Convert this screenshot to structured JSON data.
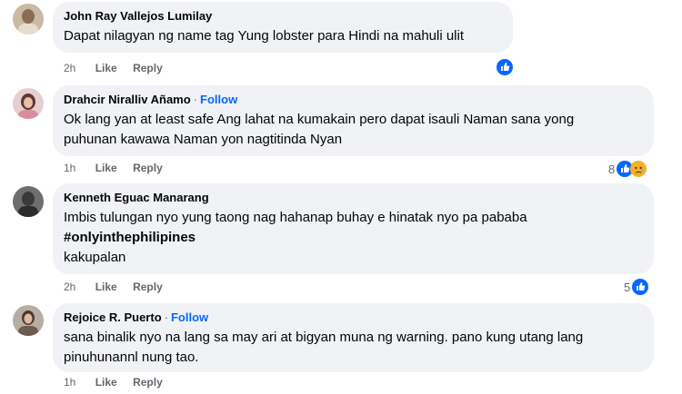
{
  "comments": [
    {
      "author": "John Ray Vallejos Lumilay",
      "follow": "",
      "lines": [
        "Dapat nilagyan ng name tag Yung lobster para Hindi na mahuli ulit"
      ],
      "hashtag": "",
      "time": "2h",
      "like": "Like",
      "reply": "Reply",
      "reaction_count": "",
      "reactions": [
        "like-icon"
      ]
    },
    {
      "author": "Drahcir Niralliv Añamo",
      "follow": "Follow",
      "lines": [
        "Ok lang yan at least safe Ang lahat na kumakain pero dapat isauli Naman sana yong",
        "puhunan kawawa Naman yon nagtitinda Nyan"
      ],
      "hashtag": "",
      "time": "1h",
      "like": "Like",
      "reply": "Reply",
      "reaction_count": "8",
      "reactions": [
        "like-icon",
        "sad-icon"
      ]
    },
    {
      "author": "Kenneth Eguac Manarang",
      "follow": "",
      "lines": [
        "Imbis tulungan nyo yung taong nag hahanap buhay e hinatak nyo pa pababa"
      ],
      "hashtag": "#onlyinthephilipines",
      "extra_line": "kakupalan",
      "time": "2h",
      "like": "Like",
      "reply": "Reply",
      "reaction_count": "5",
      "reactions": [
        "like-icon"
      ]
    },
    {
      "author": "Rejoice R. Puerto",
      "follow": "Follow",
      "lines": [
        "sana binalik nyo na lang sa may ari at bigyan muna ng warning. pano kung utang lang",
        "pinuhunannl nung tao."
      ],
      "hashtag": "",
      "time": "1h",
      "like": "Like",
      "reply": "Reply",
      "reaction_count": "",
      "reactions": []
    }
  ],
  "colors": {
    "bubble": "#f0f2f5",
    "link_blue": "#0866ff",
    "meta_gray": "#65676b"
  }
}
